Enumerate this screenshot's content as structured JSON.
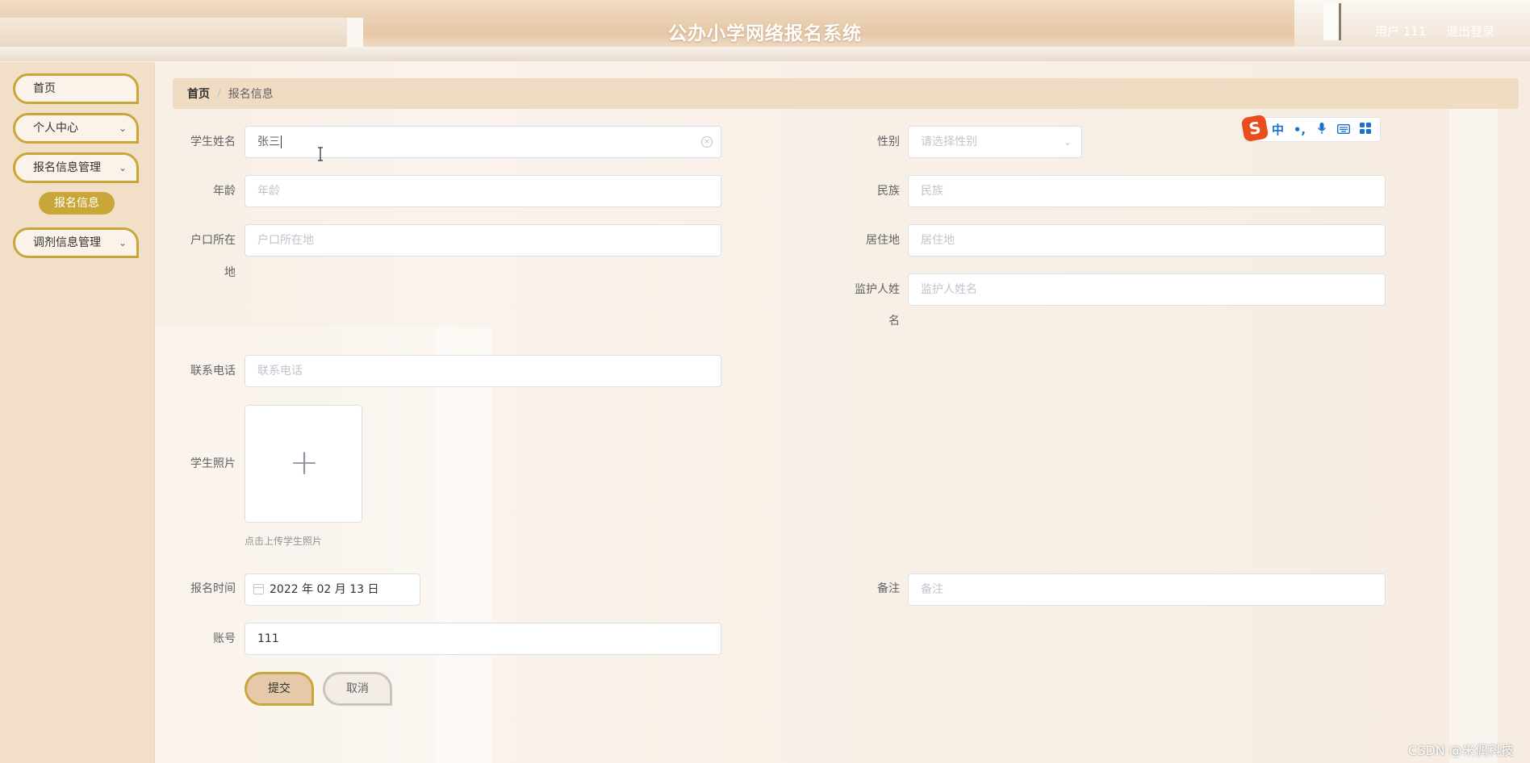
{
  "header": {
    "title": "公办小学网络报名系统",
    "user": "用户 111",
    "logout": "退出登录"
  },
  "sidebar": {
    "items": [
      {
        "label": "首页"
      },
      {
        "label": "个人中心"
      },
      {
        "label": "报名信息管理"
      },
      {
        "label": "调剂信息管理"
      }
    ],
    "sub_item": "报名信息",
    "chevron": "chevron-down-icon"
  },
  "breadcrumb": {
    "home": "首页",
    "separator": "/",
    "current": "报名信息"
  },
  "form": {
    "name": {
      "label": "学生姓名",
      "value": "张三"
    },
    "gender": {
      "label": "性别",
      "placeholder": "请选择性别"
    },
    "age": {
      "label": "年龄",
      "placeholder": "年龄"
    },
    "ethnicity": {
      "label": "民族",
      "placeholder": "民族"
    },
    "hukou": {
      "label_line1": "户口所在",
      "label_line2": "地",
      "placeholder": "户口所在地"
    },
    "residence": {
      "label": "居住地",
      "placeholder": "居住地"
    },
    "guardian": {
      "label_line1": "监护人姓",
      "label_line2": "名",
      "placeholder": "监护人姓名"
    },
    "phone": {
      "label": "联系电话",
      "placeholder": "联系电话"
    },
    "photo": {
      "label": "学生照片",
      "tip": "点击上传学生照片"
    },
    "reg_time": {
      "label": "报名时间",
      "value": "2022 年 02 月 13 日"
    },
    "remark": {
      "label": "备注",
      "placeholder": "备注"
    },
    "account": {
      "label": "账号",
      "value": "111"
    },
    "submit": "提交",
    "cancel": "取消"
  },
  "ime": {
    "logo": "S",
    "mode": "中",
    "punct": "•,"
  },
  "watermark": "CSDN @米偶科技",
  "colors": {
    "accent": "#c9a63a",
    "sidebar_bg": "#f2dfc8",
    "breadcrumb_bg": "#f0dcc3"
  }
}
